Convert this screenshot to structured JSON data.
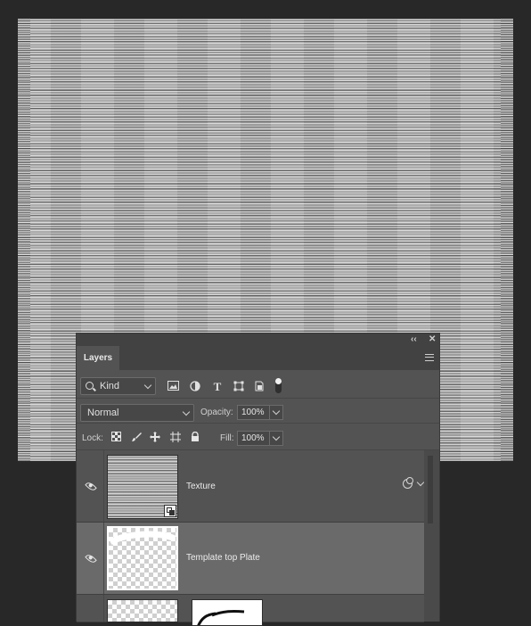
{
  "panel": {
    "collapse_label": "‹‹",
    "close_label": "✕",
    "tab_label": "Layers"
  },
  "filter": {
    "kind_label": "Kind",
    "icons": [
      "image-filter-icon",
      "adjustment-filter-icon",
      "type-filter-icon",
      "shape-filter-icon",
      "smart-object-filter-icon",
      "filter-toggle-icon"
    ]
  },
  "blend": {
    "mode": "Normal",
    "opacity_label": "Opacity:",
    "opacity_value": "100%"
  },
  "lock": {
    "label": "Lock:",
    "icons": [
      "lock-transparent-pixels-icon",
      "lock-image-pixels-icon",
      "lock-position-icon",
      "lock-artboard-icon",
      "lock-all-icon"
    ],
    "fill_label": "Fill:",
    "fill_value": "100%"
  },
  "layers": [
    {
      "name": "Texture",
      "visible": true,
      "selected": false,
      "smart_object": true,
      "clipped": true
    },
    {
      "name": "Template top Plate",
      "visible": true,
      "selected": true
    },
    {
      "name": "",
      "visible": true,
      "selected": false,
      "has_mask": true
    }
  ]
}
